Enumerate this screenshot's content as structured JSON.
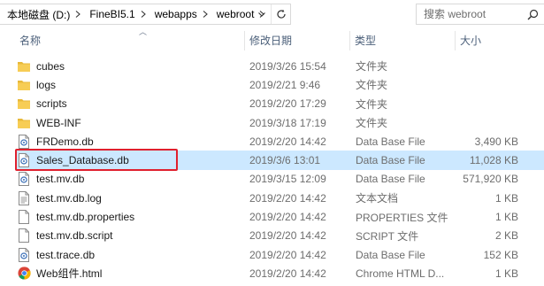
{
  "breadcrumb": [
    "本地磁盘 (D:)",
    "FineBI5.1",
    "webapps",
    "webroot"
  ],
  "search": {
    "placeholder": "搜索 webroot"
  },
  "columns": {
    "name": "名称",
    "date": "修改日期",
    "type": "类型",
    "size": "大小"
  },
  "files": [
    {
      "name": "cubes",
      "date": "2019/3/26 15:54",
      "type": "文件夹",
      "size": "",
      "icon": "folder-icon"
    },
    {
      "name": "logs",
      "date": "2019/2/21 9:46",
      "type": "文件夹",
      "size": "",
      "icon": "folder-icon"
    },
    {
      "name": "scripts",
      "date": "2019/2/20 17:29",
      "type": "文件夹",
      "size": "",
      "icon": "folder-icon"
    },
    {
      "name": "WEB-INF",
      "date": "2019/3/18 17:19",
      "type": "文件夹",
      "size": "",
      "icon": "folder-icon"
    },
    {
      "name": "FRDemo.db",
      "date": "2019/2/20 14:42",
      "type": "Data Base File",
      "size": "3,490 KB",
      "icon": "db-file-icon"
    },
    {
      "name": "Sales_Database.db",
      "date": "2019/3/6 13:01",
      "type": "Data Base File",
      "size": "11,028 KB",
      "icon": "db-file-icon"
    },
    {
      "name": "test.mv.db",
      "date": "2019/3/15 12:09",
      "type": "Data Base File",
      "size": "571,920 KB",
      "icon": "db-file-icon"
    },
    {
      "name": "test.mv.db.log",
      "date": "2019/2/20 14:42",
      "type": "文本文档",
      "size": "1 KB",
      "icon": "text-file-icon"
    },
    {
      "name": "test.mv.db.properties",
      "date": "2019/2/20 14:42",
      "type": "PROPERTIES 文件",
      "size": "1 KB",
      "icon": "blank-file-icon"
    },
    {
      "name": "test.mv.db.script",
      "date": "2019/2/20 14:42",
      "type": "SCRIPT 文件",
      "size": "2 KB",
      "icon": "blank-file-icon"
    },
    {
      "name": "test.trace.db",
      "date": "2019/2/20 14:42",
      "type": "Data Base File",
      "size": "152 KB",
      "icon": "db-file-icon"
    },
    {
      "name": "Web组件.html",
      "date": "2019/2/20 14:42",
      "type": "Chrome HTML D...",
      "size": "1 KB",
      "icon": "chrome-icon"
    }
  ],
  "selected_index": 5,
  "highlighted_index": 5,
  "colors": {
    "selection": "#cce8ff",
    "highlight_border": "#e0202e",
    "header_text": "#4c607a",
    "folder": "#e8b93a"
  }
}
